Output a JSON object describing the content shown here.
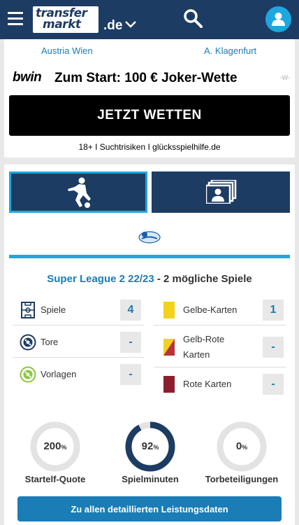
{
  "header": {
    "logo_line1": "transfer",
    "logo_line2": "markt",
    "tld": ".de"
  },
  "promo": {
    "home_team": "Austria Wien",
    "away_team": "A. Klagenfurt",
    "brand": "bwin",
    "offer": "Zum Start: 100 € Joker-Wette",
    "marker": "-W-",
    "cta": "JETZT WETTEN",
    "disclaimer": "18+ I Suchtrisiken I glücksspielhilfe.de"
  },
  "stats": {
    "league": "Super League 2 22/23",
    "suffix": " - 2 mögliche Spiele",
    "left": [
      {
        "label": "Spiele",
        "value": "4",
        "icon": "pitch-icon"
      },
      {
        "label": "Tore",
        "value": "-",
        "icon": "football-icon"
      },
      {
        "label": "Vorlagen",
        "value": "-",
        "icon": "assist-icon"
      }
    ],
    "right": [
      {
        "label": "Gelbe-Karten",
        "value": "1",
        "color": "#f2d21b"
      },
      {
        "label": "Gelb-Rote Karten",
        "value": "-",
        "color": "#b8323a"
      },
      {
        "label": "Rote Karten",
        "value": "-",
        "color": "#8b1f2e"
      }
    ],
    "donuts": [
      {
        "value": "200",
        "unit": "%",
        "label": "Startelf-Quote",
        "fraction": 1.0
      },
      {
        "value": "92",
        "unit": "%",
        "label": "Spielminuten",
        "fraction": 0.92
      },
      {
        "value": "0",
        "unit": "%",
        "label": "Torbeteiligungen",
        "fraction": 0
      }
    ],
    "details_button": "Zu allen detaillierten Leistungsdaten"
  },
  "colors": {
    "navy": "#1d3c63",
    "accent": "#1ea6e0",
    "link": "#1a7db5"
  }
}
